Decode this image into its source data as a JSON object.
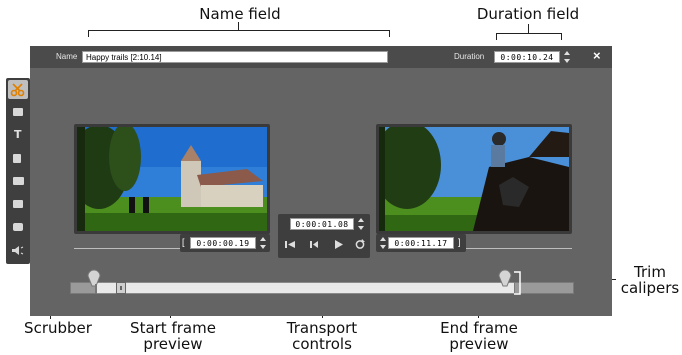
{
  "callouts": {
    "name_field": "Name field",
    "duration_field": "Duration field",
    "trim_calipers": "Trim\ncalipers",
    "scrubber": "Scrubber",
    "start_frame_preview": "Start frame\npreview",
    "transport_controls": "Transport\ncontrols",
    "end_frame_preview": "End frame\npreview"
  },
  "editor": {
    "name_label": "Name",
    "name_value": "Happy trails [2:10.14]",
    "duration_label": "Duration",
    "duration_value": "0:00:10.24",
    "close_glyph": "×"
  },
  "toolbar": {
    "items": [
      "scissors-icon",
      "photo-icon",
      "text-icon",
      "copy-icon",
      "camera-icon",
      "clapper-icon",
      "record-icon",
      "speaker-icon"
    ]
  },
  "start_preview": {
    "timecode": "0:00:00.19",
    "bracket": "["
  },
  "transport": {
    "timecode": "0:00:01.08"
  },
  "end_preview": {
    "timecode": "0:00:11.17",
    "bracket": "]"
  },
  "colors": {
    "window": "#646464",
    "titlebar": "#4b4b4b",
    "accent_active_tool": "#e08000"
  }
}
